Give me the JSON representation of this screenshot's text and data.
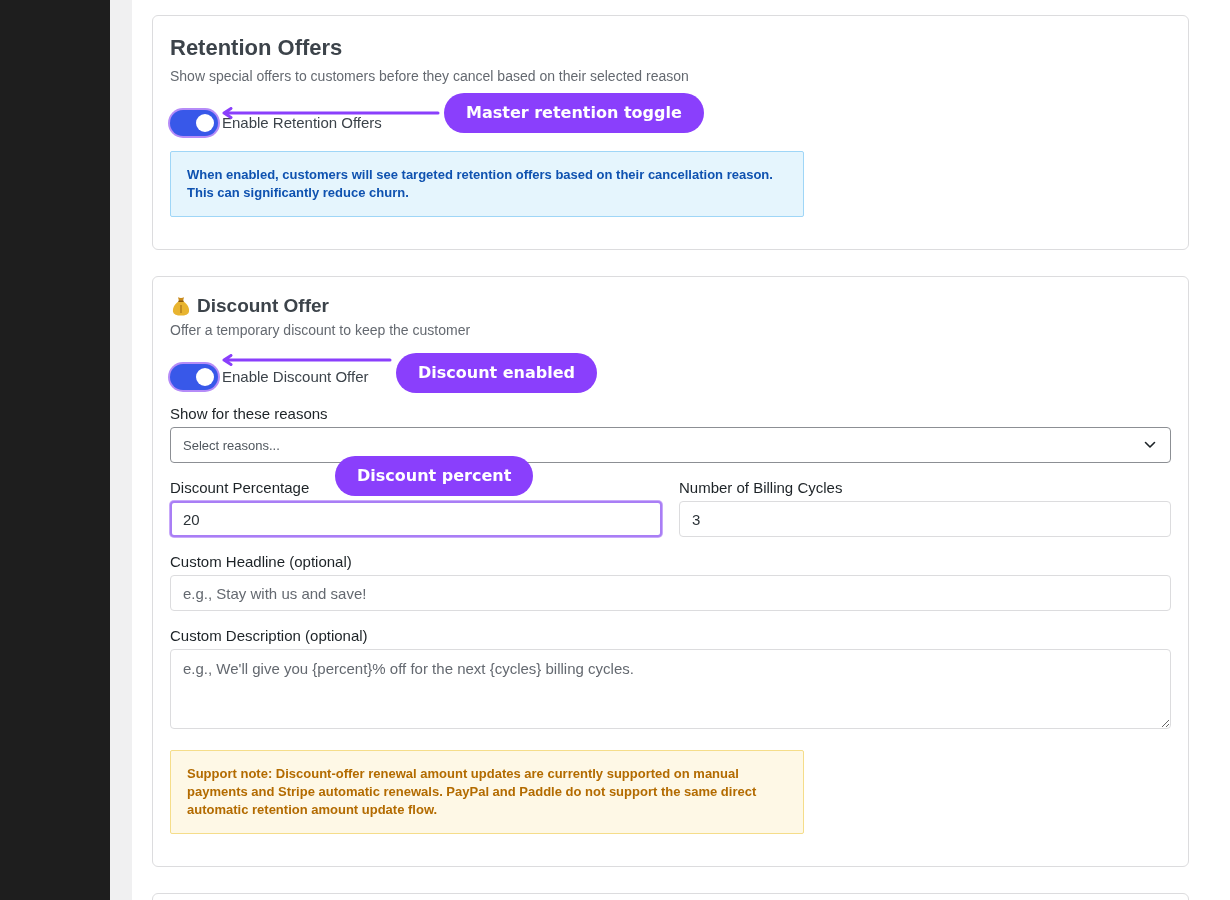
{
  "retention": {
    "title": "Retention Offers",
    "subtitle": "Show special offers to customers before they cancel based on their selected reason",
    "toggle": {
      "label": "Enable Retention Offers",
      "on": true,
      "annotation": "Master retention toggle"
    },
    "info": "When enabled, customers will see targeted retention offers based on their cancellation reason. This can significantly reduce churn."
  },
  "discount": {
    "title": "Discount Offer",
    "subtitle": "Offer a temporary discount to keep the customer",
    "toggle": {
      "label": "Enable Discount Offer",
      "on": true,
      "annotation": "Discount enabled"
    },
    "reasons": {
      "label": "Show for these reasons",
      "placeholder": "Select reasons..."
    },
    "fields": [
      {
        "label": "Discount Percentage",
        "value": "20",
        "focused": true,
        "annotation": "Discount percent"
      },
      {
        "label": "Number of Billing Cycles",
        "value": "3",
        "focused": false
      }
    ],
    "headline": {
      "label": "Custom Headline (optional)",
      "placeholder": "e.g., Stay with us and save!"
    },
    "description": {
      "label": "Custom Description (optional)",
      "placeholder": "e.g., We'll give you {percent}% off for the next {cycles} billing cycles."
    },
    "note": "Support note: Discount-offer renewal amount updates are currently supported on manual payments and Stripe automatic renewals. PayPal and Paddle do not support the same direct automatic retention amount update flow."
  }
}
